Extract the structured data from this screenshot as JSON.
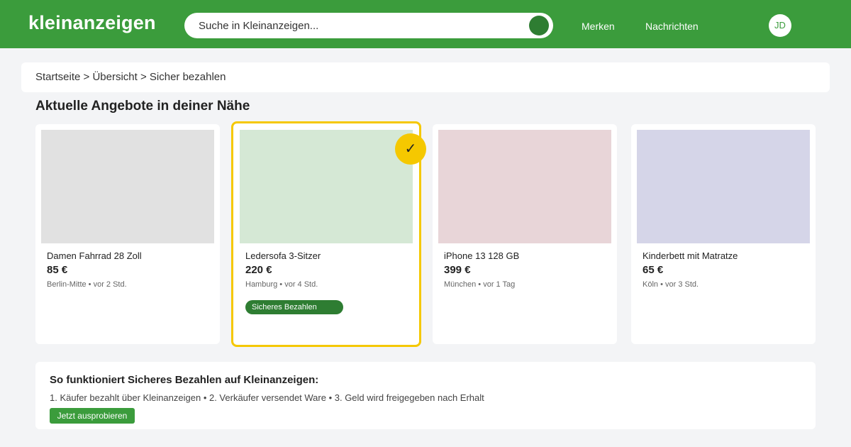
{
  "header": {
    "logo": "kleinanzeigen",
    "search_placeholder": "Suche in Kleinanzeigen...",
    "nav": [
      "Merken",
      "Nachrichten"
    ],
    "avatar_initials": "JD"
  },
  "breadcrumb": "Startseite > Übersicht > Sicher bezahlen",
  "section_title": "Aktuelle Angebote in deiner Nähe",
  "listings": [
    {
      "title": "Damen Fahrrad 28 Zoll",
      "price": "85 €",
      "meta": "Berlin-Mitte • vor 2 Std.",
      "image_color": "#e1e1e1"
    },
    {
      "title": "Ledersofa 3-Sitzer",
      "price": "220 €",
      "meta": "Hamburg • vor 4 Std.",
      "image_color": "#d5e8d5",
      "badge": "Sicheres Bezahlen",
      "selected": true
    },
    {
      "title": "iPhone 13 128 GB",
      "price": "399 €",
      "meta": "München • vor 1 Tag",
      "image_color": "#e8d5d8"
    },
    {
      "title": "Kinderbett mit Matratze",
      "price": "65 €",
      "meta": "Köln • vor 3 Std.",
      "image_color": "#d5d5e8"
    }
  ],
  "selected_check": "✓",
  "info": {
    "title": "So funktioniert Sicheres Bezahlen auf Kleinanzeigen:",
    "steps": "1. Käufer bezahlt über Kleinanzeigen • 2. Verkäufer versendet Ware • 3. Geld wird freigegeben nach Erhalt",
    "cta_label": "Jetzt ausprobieren"
  },
  "colors": {
    "brand_green": "#3b9c3c",
    "dark_green": "#2e7d32",
    "highlight_yellow": "#f5c800"
  }
}
